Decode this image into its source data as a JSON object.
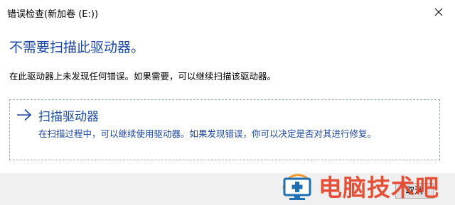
{
  "window": {
    "title": "错误检查(新加卷 (E:))",
    "close_glyph": "×"
  },
  "main": {
    "heading": "不需要扫描此驱动器。",
    "description": "在此驱动器上未发现任何错误。如果需要，可以继续扫描该驱动器。"
  },
  "option": {
    "arrow_icon": "right-arrow-icon",
    "title": "扫描驱动器",
    "description": "在扫描过程中，可以继续使用驱动器。如果发现错误，你可以决定是否对其进行修复。"
  },
  "footer": {
    "cancel_label": "取消"
  },
  "watermark": {
    "text": "电脑技术吧",
    "logo_icon": "computer-monitor-icon"
  },
  "colors": {
    "accent": "#1a46a8",
    "watermark": "#e8472d"
  }
}
